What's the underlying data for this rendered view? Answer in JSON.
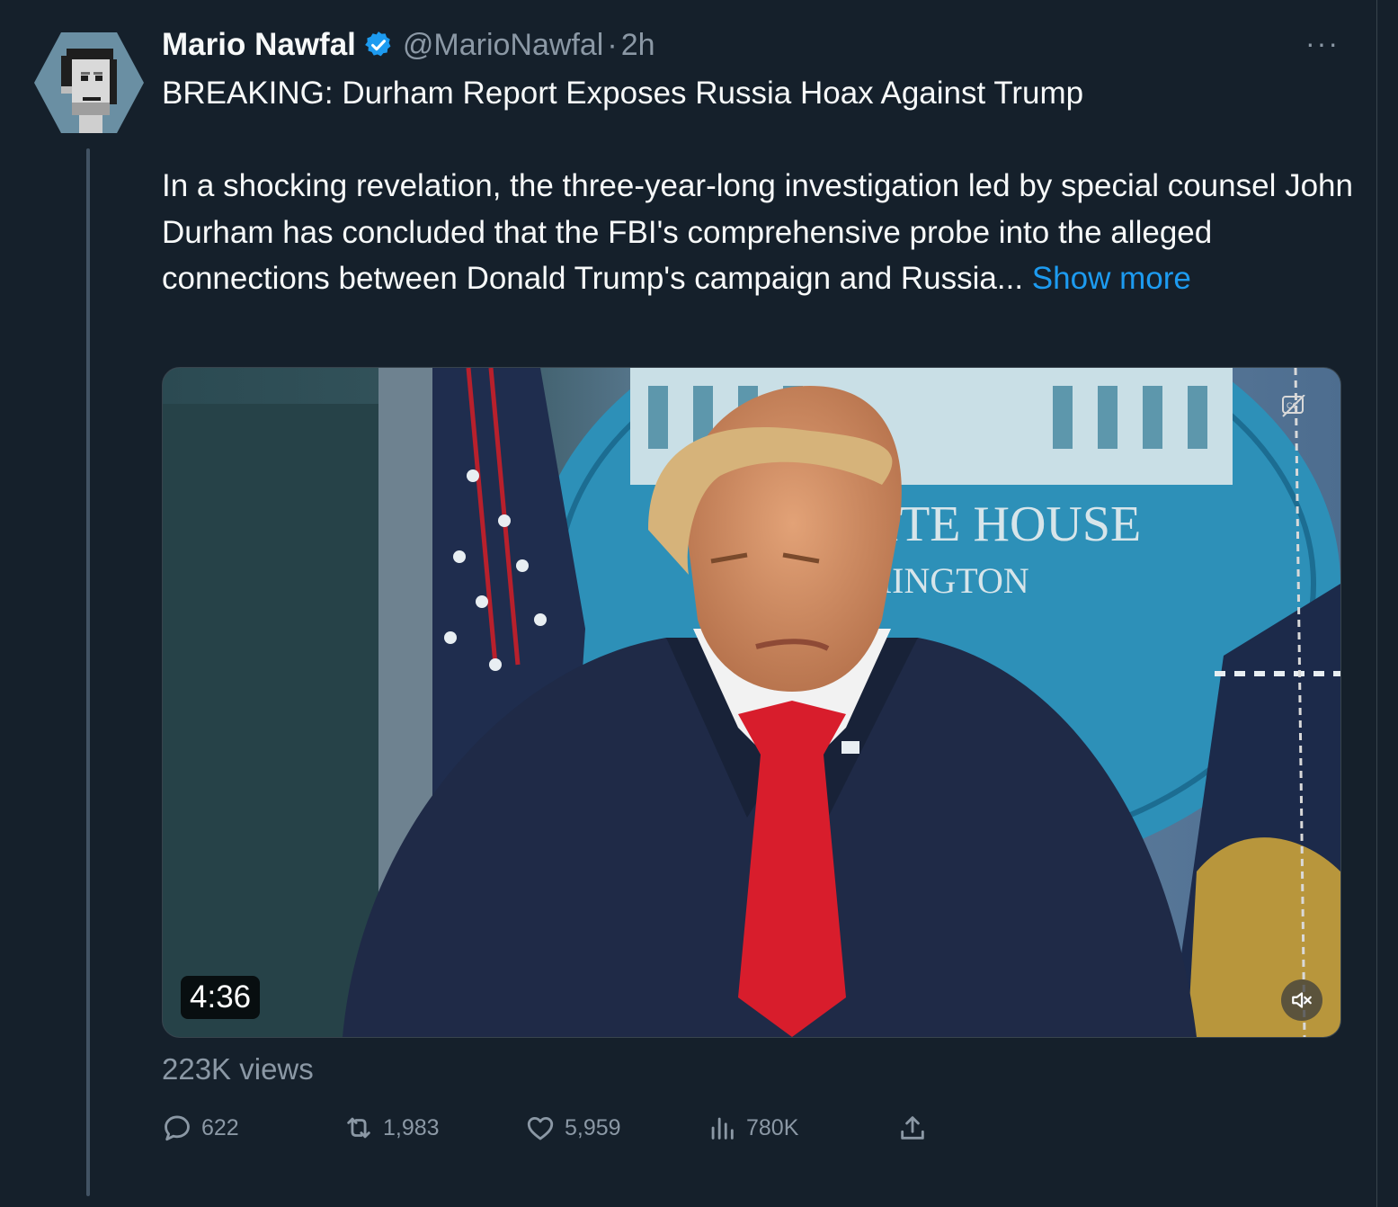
{
  "tweet": {
    "display_name": "Mario Nawfal",
    "handle": "@MarioNawfal",
    "separator": "·",
    "time": "2h",
    "more_label": "···",
    "headline": "BREAKING: Durham Report Exposes Russia Hoax Against Trump",
    "body": "In a shocking revelation, the three-year-long investigation led by special counsel John Durham has concluded that the FBI's comprehensive probe into the alleged connections between Donald Trump's campaign and Russia...",
    "show_more": "Show more",
    "views": "223K views"
  },
  "media": {
    "duration": "4:36",
    "seal_text_1": "HITE HOUSE",
    "seal_text_2": "SHINGTON"
  },
  "actions": {
    "replies": "622",
    "retweets": "1,983",
    "likes": "5,959",
    "views": "780K"
  },
  "colors": {
    "background": "#15202b",
    "accent": "#1d9bf0",
    "muted": "#8b98a5",
    "text": "#f7f9f9"
  }
}
